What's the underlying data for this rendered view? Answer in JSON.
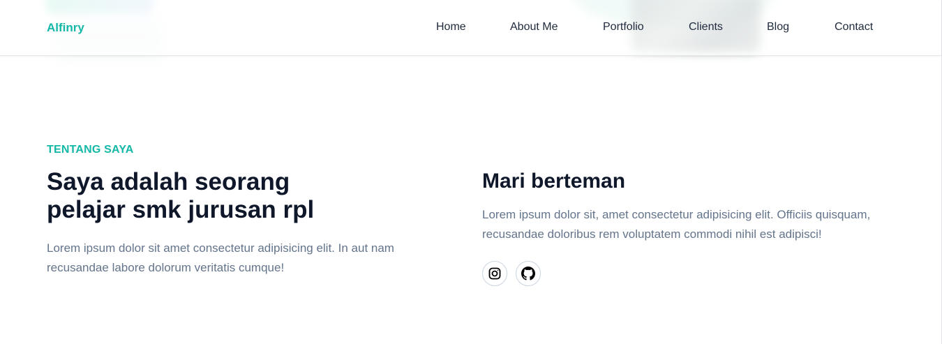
{
  "navbar": {
    "brand": "Alfinry",
    "links": [
      {
        "label": "Home"
      },
      {
        "label": "About Me"
      },
      {
        "label": "Portfolio"
      },
      {
        "label": "Clients"
      },
      {
        "label": "Blog"
      },
      {
        "label": "Contact"
      }
    ]
  },
  "about": {
    "eyebrow": "TENTANG SAYA",
    "headline": "Saya adalah seorang pelajar smk jurusan rpl",
    "description": "Lorem ipsum dolor sit amet consectetur adipisicing elit. In aut nam recusandae labore dolorum veritatis cumque!"
  },
  "connect": {
    "title": "Mari berteman",
    "description": "Lorem ipsum dolor sit, amet consectetur adipisicing elit. Officiis quisquam, recusandae doloribus rem voluptatem commodi nihil est adipisci!",
    "socials": [
      {
        "icon": "instagram-icon"
      },
      {
        "icon": "github-icon"
      }
    ]
  },
  "colors": {
    "accent": "#14b8a6",
    "heading": "#0f172a",
    "body_text": "#64748b",
    "nav_text": "#1e293b"
  }
}
